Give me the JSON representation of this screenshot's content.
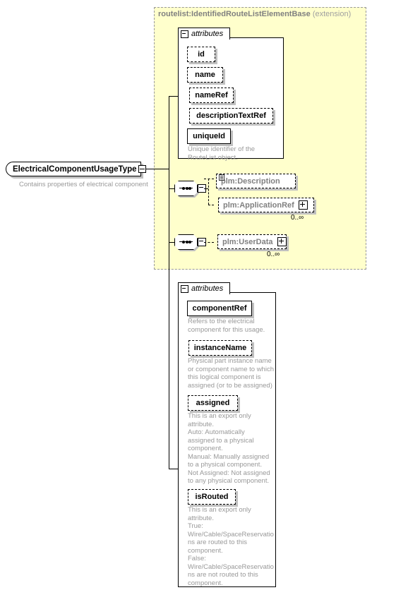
{
  "diagram": {
    "type_box": {
      "name": "ElectricalComponentUsageType",
      "documentation": "Contains properties of electrical component",
      "collapse_icon": "minus-icon"
    },
    "extension": {
      "base_type": "routelist:IdentifiedRouteListElementBase",
      "kind": "(extension)"
    },
    "base_attributes": {
      "label": "attributes",
      "items": [
        {
          "name": "id",
          "required": false
        },
        {
          "name": "name",
          "required": false
        },
        {
          "name": "nameRef",
          "required": false
        },
        {
          "name": "descriptionTextRef",
          "required": false
        },
        {
          "name": "uniqueId",
          "required": true,
          "documentation": "Unique identifier of the\nRouteList object."
        }
      ]
    },
    "sequences": [
      {
        "id": "sequence-1",
        "elements": [
          {
            "name": "plm:Description",
            "expandable": false,
            "cardinality": "",
            "icon": "document-icon"
          },
          {
            "name": "plm:ApplicationRef",
            "expandable": true,
            "cardinality": "0..∞"
          }
        ]
      },
      {
        "id": "sequence-2",
        "elements": [
          {
            "name": "plm:UserData",
            "expandable": true,
            "cardinality": "0..∞"
          }
        ]
      }
    ],
    "own_attributes": {
      "label": "attributes",
      "items": [
        {
          "name": "componentRef",
          "required": true,
          "documentation": "Refers to the electrical\ncomponent for this usage."
        },
        {
          "name": "instanceName",
          "required": false,
          "documentation": "Physical part instance name\nor component name to which\nthis logical component is\nassigned (or to be assigned)"
        },
        {
          "name": "assigned",
          "required": false,
          "documentation": "This is an export only\nattribute.\nAuto:  Automatically\nassigned to a physical\ncomponent.\nManual: Manually assigned\nto a physical component.\nNot Assigned: Not assigned\nto any physical component."
        },
        {
          "name": "isRouted",
          "required": false,
          "documentation": "This is an export only\nattribute.\nTrue:\nWire/Cable/SpaceReservatio\nns are routed to this\ncomponent.\nFalse:\nWire/Cable/SpaceReservatio\nns are not routed to this\ncomponent."
        }
      ]
    },
    "colors": {
      "extension_fill": "#ffffcc",
      "extension_border": "#999999",
      "shadow": "#c0c0c0",
      "muted_text": "#999999",
      "element_text": "#808080"
    }
  }
}
